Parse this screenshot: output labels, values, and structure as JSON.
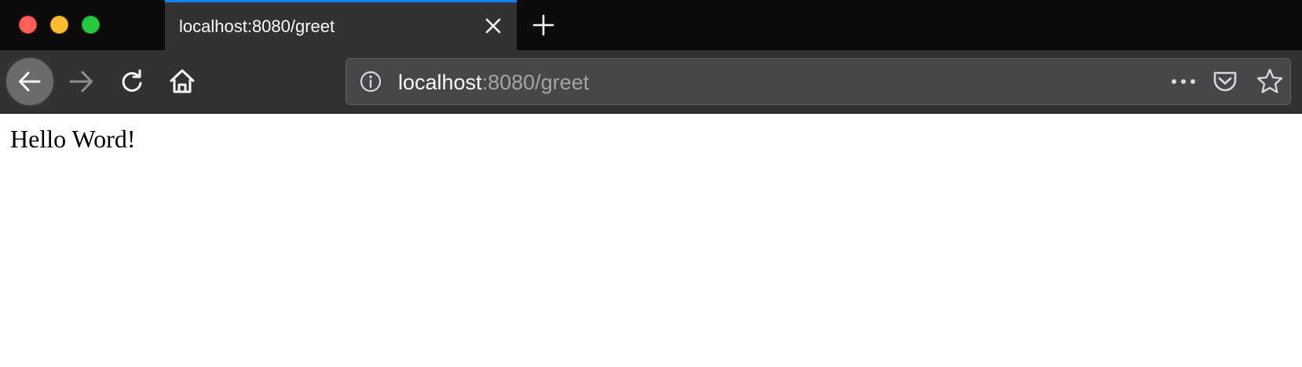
{
  "tab": {
    "title": "localhost:8080/greet"
  },
  "urlbar": {
    "host": "localhost",
    "path": ":8080/greet"
  },
  "icons": {
    "back": "back-arrow-icon",
    "forward": "forward-arrow-icon",
    "reload": "reload-icon",
    "home": "home-icon",
    "site_info": "info-icon",
    "page_actions": "more-horizontal-icon",
    "pocket": "pocket-icon",
    "bookmark": "star-icon",
    "tab_close": "close-icon",
    "new_tab": "plus-icon"
  },
  "colors": {
    "tab_accent": "#0a84ff",
    "traffic_close": "#fe5f57",
    "traffic_minimize": "#febc2e",
    "traffic_maximize": "#28c840"
  },
  "page": {
    "body_text": "Hello Word!"
  }
}
